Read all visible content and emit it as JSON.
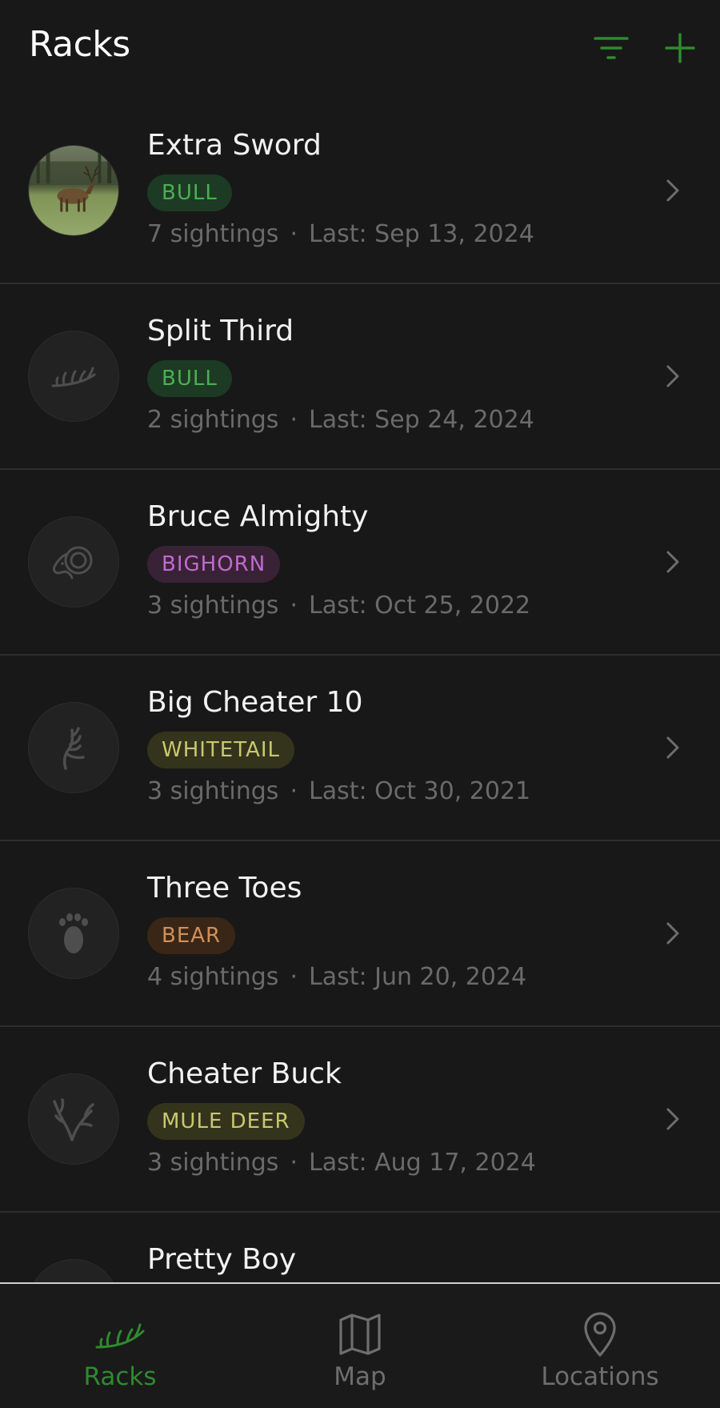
{
  "header": {
    "title": "Racks",
    "filter_icon": "filter-icon",
    "add_icon": "plus-icon"
  },
  "colors": {
    "accent": "#2e8a2e",
    "bull_text": "#4caf50",
    "bull_bg": "#1d3a24",
    "bighorn_text": "#c06ad0",
    "bighorn_bg": "#3a2236",
    "whitetail_text": "#c8c870",
    "whitetail_bg": "#34331c",
    "bear_text": "#d0905a",
    "bear_bg": "#3a2616",
    "mule_deer_text": "#c8c870",
    "mule_deer_bg": "#34331c"
  },
  "racks": [
    {
      "name": "Extra Sword",
      "badge": "BULL",
      "sightings": "7 sightings",
      "dot": "·",
      "last": "Last: Sep 13, 2024",
      "icon": "elk-photo"
    },
    {
      "name": "Split Third",
      "badge": "BULL",
      "sightings": "2 sightings",
      "dot": "·",
      "last": "Last: Sep 24, 2024",
      "icon": "elk-antler-icon"
    },
    {
      "name": "Bruce Almighty",
      "badge": "BIGHORN",
      "sightings": "3 sightings",
      "dot": "·",
      "last": "Last: Oct 25, 2022",
      "icon": "ram-icon"
    },
    {
      "name": "Big Cheater 10",
      "badge": "WHITETAIL",
      "sightings": "3 sightings",
      "dot": "·",
      "last": "Last: Oct 30, 2021",
      "icon": "whitetail-antler-icon"
    },
    {
      "name": "Three Toes",
      "badge": "BEAR",
      "sightings": "4 sightings",
      "dot": "·",
      "last": "Last: Jun 20, 2024",
      "icon": "bear-paw-icon"
    },
    {
      "name": "Cheater Buck",
      "badge": "MULE DEER",
      "sightings": "3 sightings",
      "dot": "·",
      "last": "Last: Aug 17, 2024",
      "icon": "mule-deer-antler-icon"
    },
    {
      "name": "Pretty Boy",
      "icon": "avatar-placeholder"
    }
  ],
  "nav": {
    "racks": {
      "label": "Racks",
      "icon": "antler-icon",
      "active": true
    },
    "map": {
      "label": "Map",
      "icon": "map-icon"
    },
    "locations": {
      "label": "Locations",
      "icon": "location-pin-icon"
    }
  }
}
